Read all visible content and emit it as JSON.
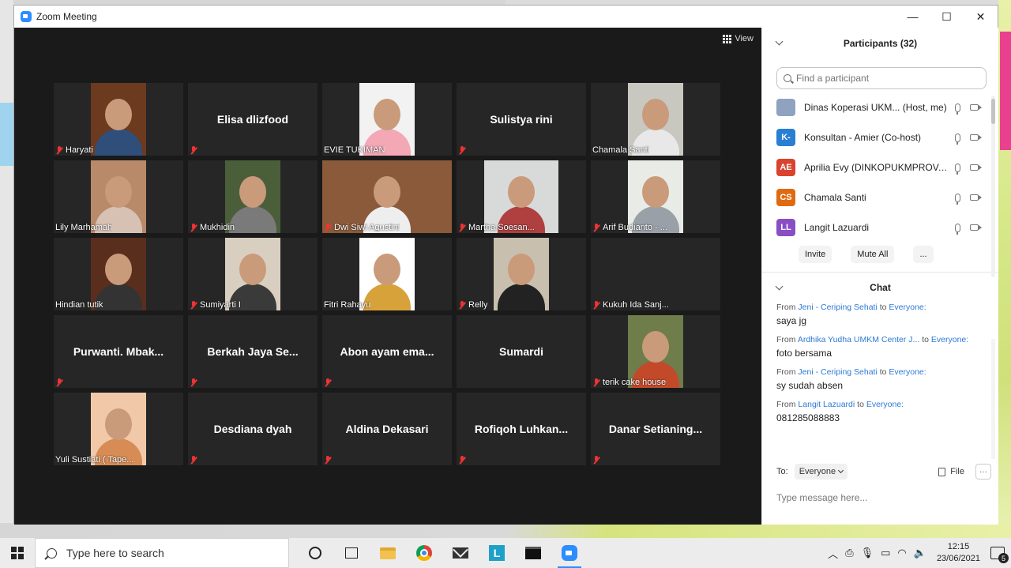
{
  "window": {
    "title": "Zoom Meeting",
    "minimize": "—",
    "maximize": "☐",
    "close": "✕"
  },
  "video": {
    "view_label": "View"
  },
  "tiles": [
    {
      "name": "Haryati",
      "video": true,
      "muted": true,
      "bg": "#6b3a1f",
      "shirt": "#2f4f7a"
    },
    {
      "name": "Elisa dlizfood",
      "video": false,
      "muted": true
    },
    {
      "name": "EVIE TUKIMAN",
      "video": true,
      "muted": false,
      "bg": "#f2f2f2",
      "shirt": "#f4a7b5"
    },
    {
      "name": "Sulistya rini",
      "video": false,
      "muted": true
    },
    {
      "name": "Chamala Santi",
      "video": true,
      "muted": false,
      "bg": "#c8c8c0",
      "shirt": "#e8e8e8"
    },
    {
      "name": "Lily Marhamah",
      "video": true,
      "muted": false,
      "bg": "#b88a6a",
      "shirt": "#d7c1b3"
    },
    {
      "name": "Mukhidin",
      "video": true,
      "muted": true,
      "bg": "#4b5e3a",
      "shirt": "#7a7a7a"
    },
    {
      "name": "Dwi Siwi Agustini",
      "video": true,
      "muted": true,
      "bg": "#8a5a3a",
      "shirt": "#eeeeee"
    },
    {
      "name": "Martha Soesan...",
      "video": true,
      "muted": true,
      "bg": "#d8dada",
      "shirt": "#b04040"
    },
    {
      "name": "Arif Budianto - ...",
      "video": true,
      "muted": true,
      "bg": "#e9ece6",
      "shirt": "#9aa0a8"
    },
    {
      "name": "Hindian tutik",
      "video": true,
      "muted": false,
      "bg": "#5a2e1c",
      "shirt": "#333333"
    },
    {
      "name": "Sumiyarti I",
      "video": true,
      "muted": true,
      "bg": "#d9cfc0",
      "shirt": "#3a3a3a"
    },
    {
      "name": "Fitri Rahayu",
      "video": true,
      "muted": false,
      "bg": "#ffffff",
      "shirt": "#d8a23a"
    },
    {
      "name": "Relly",
      "video": true,
      "muted": true,
      "bg": "#c9bfae",
      "shirt": "#222222"
    },
    {
      "name": "Kukuh Ida Sanj...",
      "video": false,
      "muted": true,
      "showName": false
    },
    {
      "name": "Purwanti.  Mbak...",
      "video": false,
      "muted": true
    },
    {
      "name": "Berkah Jaya Se...",
      "video": false,
      "muted": true
    },
    {
      "name": "Abon ayam  ema...",
      "video": false,
      "muted": true
    },
    {
      "name": "Sumardi",
      "video": false,
      "muted": false
    },
    {
      "name": "terik cake house",
      "video": true,
      "muted": true,
      "bg": "#6e7d4a",
      "shirt": "#c24a2a"
    },
    {
      "name": "Yuli Sustiati ( Tape...",
      "video": true,
      "muted": false,
      "bg": "#f1c9a8",
      "shirt": "#d78b55"
    },
    {
      "name": "Desdiana dyah",
      "video": false,
      "muted": true
    },
    {
      "name": "Aldina Dekasari",
      "video": false,
      "muted": true
    },
    {
      "name": "Rofiqoh  Luhkan...",
      "video": false,
      "muted": true
    },
    {
      "name": "Danar  Setianing...",
      "video": false,
      "muted": true
    }
  ],
  "participants": {
    "title": "Participants (32)",
    "search_placeholder": "Find a participant",
    "list": [
      {
        "initials": "",
        "name": "Dinas Koperasi UKM... (Host, me)",
        "color": "#8fa3c0"
      },
      {
        "initials": "K-",
        "name": "Konsultan - Amier (Co-host)",
        "color": "#2a7fd4"
      },
      {
        "initials": "AE",
        "name": "Aprilia Evy (DINKOPUKMPROV.J...",
        "color": "#d9432f"
      },
      {
        "initials": "CS",
        "name": "Chamala Santi",
        "color": "#e06a12"
      },
      {
        "initials": "LL",
        "name": "Langit Lazuardi",
        "color": "#8a4ec4"
      }
    ],
    "invite": "Invite",
    "mute_all": "Mute All",
    "more": "..."
  },
  "chat": {
    "title": "Chat",
    "messages": [
      {
        "from_prefix": "From ",
        "from": "Jeni - Ceriping Sehati",
        "to_prefix": " to ",
        "to": "Everyone:",
        "text": "saya jg"
      },
      {
        "from_prefix": "From ",
        "from": "Ardhika Yudha UMKM Center J...",
        "to_prefix": " to ",
        "to": "Everyone:",
        "text": "foto bersama"
      },
      {
        "from_prefix": "From ",
        "from": "Jeni - Ceriping Sehati",
        "to_prefix": " to ",
        "to": "Everyone:",
        "text": "sy sudah absen"
      },
      {
        "from_prefix": "From ",
        "from": "Langit Lazuardi",
        "to_prefix": " to ",
        "to": "Everyone:",
        "text": "081285088883"
      }
    ],
    "to_label": "To:",
    "to_value": "Everyone",
    "file_label": "File",
    "more": "···",
    "input_placeholder": "Type message here..."
  },
  "taskbar": {
    "search_placeholder": "Type here to search",
    "time": "12:15",
    "date": "23/06/2021",
    "notifications": "5"
  }
}
